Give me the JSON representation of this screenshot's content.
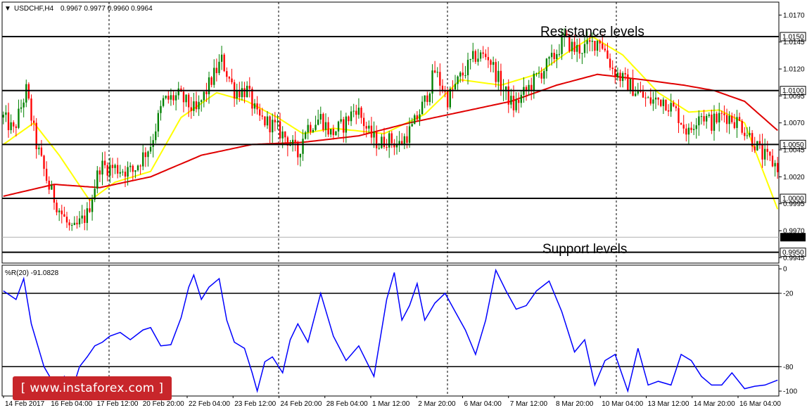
{
  "header": {
    "dropdown_glyph": "▼",
    "title": "USDCHF,H4",
    "ohlc": "0.9967 0.9977 0.9960 0.9964"
  },
  "annotations": {
    "resistance": "Resistance levels",
    "support": "Support levels"
  },
  "indicator": {
    "label": "%R(20) -91.0828"
  },
  "watermark": {
    "text": "[ www.instaforex.com ]"
  },
  "colors": {
    "bull": "#008000",
    "bear": "#ff0000",
    "fast_ma": "#ffff00",
    "slow_ma": "#e00000",
    "williams": "#0000ff",
    "watermark_bg": "#c8262b"
  },
  "chart_data": [
    {
      "type": "candlestick",
      "symbol": "USDCHF",
      "timeframe": "H4",
      "ylim": [
        0.994,
        1.0182
      ],
      "price_ticks": [
        "1.0170",
        "1.0145",
        "1.0120",
        "1.0095",
        "1.0070",
        "1.0045",
        "1.0020",
        "0.9995",
        "0.9970",
        "0.9945"
      ],
      "price_tick_values": [
        1.017,
        1.0145,
        1.012,
        1.0095,
        1.007,
        1.0045,
        1.002,
        0.9995,
        0.997,
        0.9945
      ],
      "level_tags": [
        "1.0150",
        "1.0100",
        "1.0050",
        "1.0000",
        "0.9950"
      ],
      "level_values": [
        1.015,
        1.01,
        1.005,
        1.0,
        0.995
      ],
      "current_price": "0.9964",
      "current_price_value": 0.9964,
      "x_tick_labels": [
        "14 Feb 2017",
        "16 Feb 04:00",
        "17 Feb 12:00",
        "20 Feb 20:00",
        "22 Feb 04:00",
        "23 Feb 12:00",
        "24 Feb 20:00",
        "28 Feb 04:00",
        "1 Mar 12:00",
        "2 Mar 20:00",
        "6 Mar 04:00",
        "7 Mar 12:00",
        "8 Mar 20:00",
        "10 Mar 04:00",
        "13 Mar 12:00",
        "14 Mar 20:00",
        "16 Mar 04:00"
      ],
      "close_path": [
        [
          0,
          1.0075
        ],
        [
          4,
          1.0062
        ],
        [
          9,
          1.01
        ],
        [
          13,
          1.005
        ],
        [
          18,
          1.001
        ],
        [
          22,
          0.999
        ],
        [
          27,
          0.9968
        ],
        [
          33,
          0.9985
        ],
        [
          38,
          1.003
        ],
        [
          44,
          1.0028
        ],
        [
          51,
          1.0025
        ],
        [
          58,
          1.005
        ],
        [
          63,
          1.009
        ],
        [
          69,
          1.0095
        ],
        [
          76,
          1.008
        ],
        [
          82,
          1.011
        ],
        [
          86,
          1.0128
        ],
        [
          91,
          1.01
        ],
        [
          96,
          1.01
        ],
        [
          100,
          1.0075
        ],
        [
          106,
          1.0068
        ],
        [
          112,
          1.0055
        ],
        [
          116,
          1.004
        ],
        [
          119,
          1.0065
        ],
        [
          125,
          1.0075
        ],
        [
          129,
          1.006
        ],
        [
          134,
          1.0068
        ],
        [
          139,
          1.0085
        ],
        [
          144,
          1.006
        ],
        [
          148,
          1.005
        ],
        [
          151,
          1.0055
        ],
        [
          156,
          1.005
        ],
        [
          161,
          1.0065
        ],
        [
          166,
          1.009
        ],
        [
          170,
          1.0118
        ],
        [
          175,
          1.0092
        ],
        [
          180,
          1.0112
        ],
        [
          186,
          1.0132
        ],
        [
          191,
          1.0132
        ],
        [
          196,
          1.0105
        ],
        [
          201,
          1.0085
        ],
        [
          206,
          1.01
        ],
        [
          211,
          1.0115
        ],
        [
          216,
          1.0128
        ],
        [
          221,
          1.0148
        ],
        [
          225,
          1.0138
        ],
        [
          230,
          1.014
        ],
        [
          235,
          1.0148
        ],
        [
          240,
          1.012
        ],
        [
          244,
          1.011
        ],
        [
          249,
          1.01
        ],
        [
          254,
          1.009
        ],
        [
          260,
          1.0092
        ],
        [
          265,
          1.008
        ],
        [
          270,
          1.006
        ],
        [
          274,
          1.008
        ],
        [
          279,
          1.007
        ],
        [
          284,
          1.0078
        ],
        [
          290,
          1.007
        ],
        [
          295,
          1.0055
        ],
        [
          299,
          1.004
        ],
        [
          305,
          1.003
        ]
      ],
      "n_bars": 306,
      "moving_averages": [
        {
          "color_key": "fast_ma",
          "path": [
            [
              0,
              1.005
            ],
            [
              12,
              1.007
            ],
            [
              22,
              1.004
            ],
            [
              34,
              0.9998
            ],
            [
              44,
              1.0015
            ],
            [
              58,
              1.0025
            ],
            [
              70,
              1.0075
            ],
            [
              84,
              1.0098
            ],
            [
              96,
              1.009
            ],
            [
              108,
              1.0075
            ],
            [
              118,
              1.006
            ],
            [
              130,
              1.0065
            ],
            [
              150,
              1.006
            ],
            [
              166,
              1.0078
            ],
            [
              180,
              1.011
            ],
            [
              196,
              1.0105
            ],
            [
              210,
              1.0115
            ],
            [
              222,
              1.0135
            ],
            [
              232,
              1.015
            ],
            [
              244,
              1.0133
            ],
            [
              258,
              1.0098
            ],
            [
              270,
              1.008
            ],
            [
              282,
              1.0082
            ],
            [
              292,
              1.007
            ],
            [
              305,
              0.999
            ]
          ]
        },
        {
          "color_key": "slow_ma",
          "path": [
            [
              0,
              1.0002
            ],
            [
              20,
              1.0013
            ],
            [
              38,
              1.001
            ],
            [
              58,
              1.002
            ],
            [
              78,
              1.004
            ],
            [
              98,
              1.005
            ],
            [
              118,
              1.0052
            ],
            [
              140,
              1.0058
            ],
            [
              160,
              1.007
            ],
            [
              180,
              1.008
            ],
            [
              200,
              1.009
            ],
            [
              218,
              1.0105
            ],
            [
              234,
              1.0115
            ],
            [
              252,
              1.011
            ],
            [
              268,
              1.0105
            ],
            [
              280,
              1.01
            ],
            [
              292,
              1.009
            ],
            [
              305,
              1.0063
            ]
          ]
        }
      ]
    },
    {
      "type": "line",
      "name": "%R(20)",
      "ylim": [
        -104,
        3
      ],
      "axis_ticks": [
        "0",
        "-20",
        "-80",
        "-100"
      ],
      "axis_tick_values": [
        0,
        -20,
        -80,
        -100
      ],
      "level_values": [
        -20,
        -80
      ],
      "x": [
        0,
        5,
        8,
        11,
        16,
        21,
        24,
        27,
        30,
        33,
        36,
        39,
        42,
        46,
        50,
        55,
        58,
        62,
        66,
        70,
        73,
        75,
        78,
        81,
        85,
        88,
        91,
        95,
        98,
        100,
        103,
        106,
        110,
        113,
        116,
        120,
        125,
        130,
        135,
        140,
        146,
        151,
        154,
        157,
        160,
        163,
        166,
        170,
        174,
        178,
        182,
        186,
        190,
        194,
        198,
        202,
        206,
        210,
        215,
        220,
        225,
        229,
        233,
        237,
        241,
        246,
        250,
        254,
        258,
        263,
        267,
        271,
        275,
        279,
        283,
        287,
        292,
        296,
        300,
        305
      ],
      "values": [
        -18,
        -25,
        -8,
        -45,
        -80,
        -98,
        -88,
        -100,
        -80,
        -72,
        -63,
        -60,
        -55,
        -52,
        -58,
        -50,
        -48,
        -63,
        -62,
        -40,
        -15,
        -5,
        -25,
        -15,
        -8,
        -42,
        -60,
        -65,
        -85,
        -100,
        -76,
        -72,
        -85,
        -58,
        -45,
        -60,
        -20,
        -55,
        -75,
        -63,
        -88,
        -25,
        -3,
        -42,
        -30,
        -12,
        -42,
        -28,
        -20,
        -35,
        -50,
        -70,
        -42,
        -1,
        -18,
        -33,
        -30,
        -18,
        -10,
        -35,
        -68,
        -58,
        -95,
        -75,
        -70,
        -100,
        -65,
        -95,
        -92,
        -95,
        -70,
        -75,
        -88,
        -95,
        -95,
        -85,
        -98,
        -96,
        -95,
        -91
      ]
    }
  ]
}
